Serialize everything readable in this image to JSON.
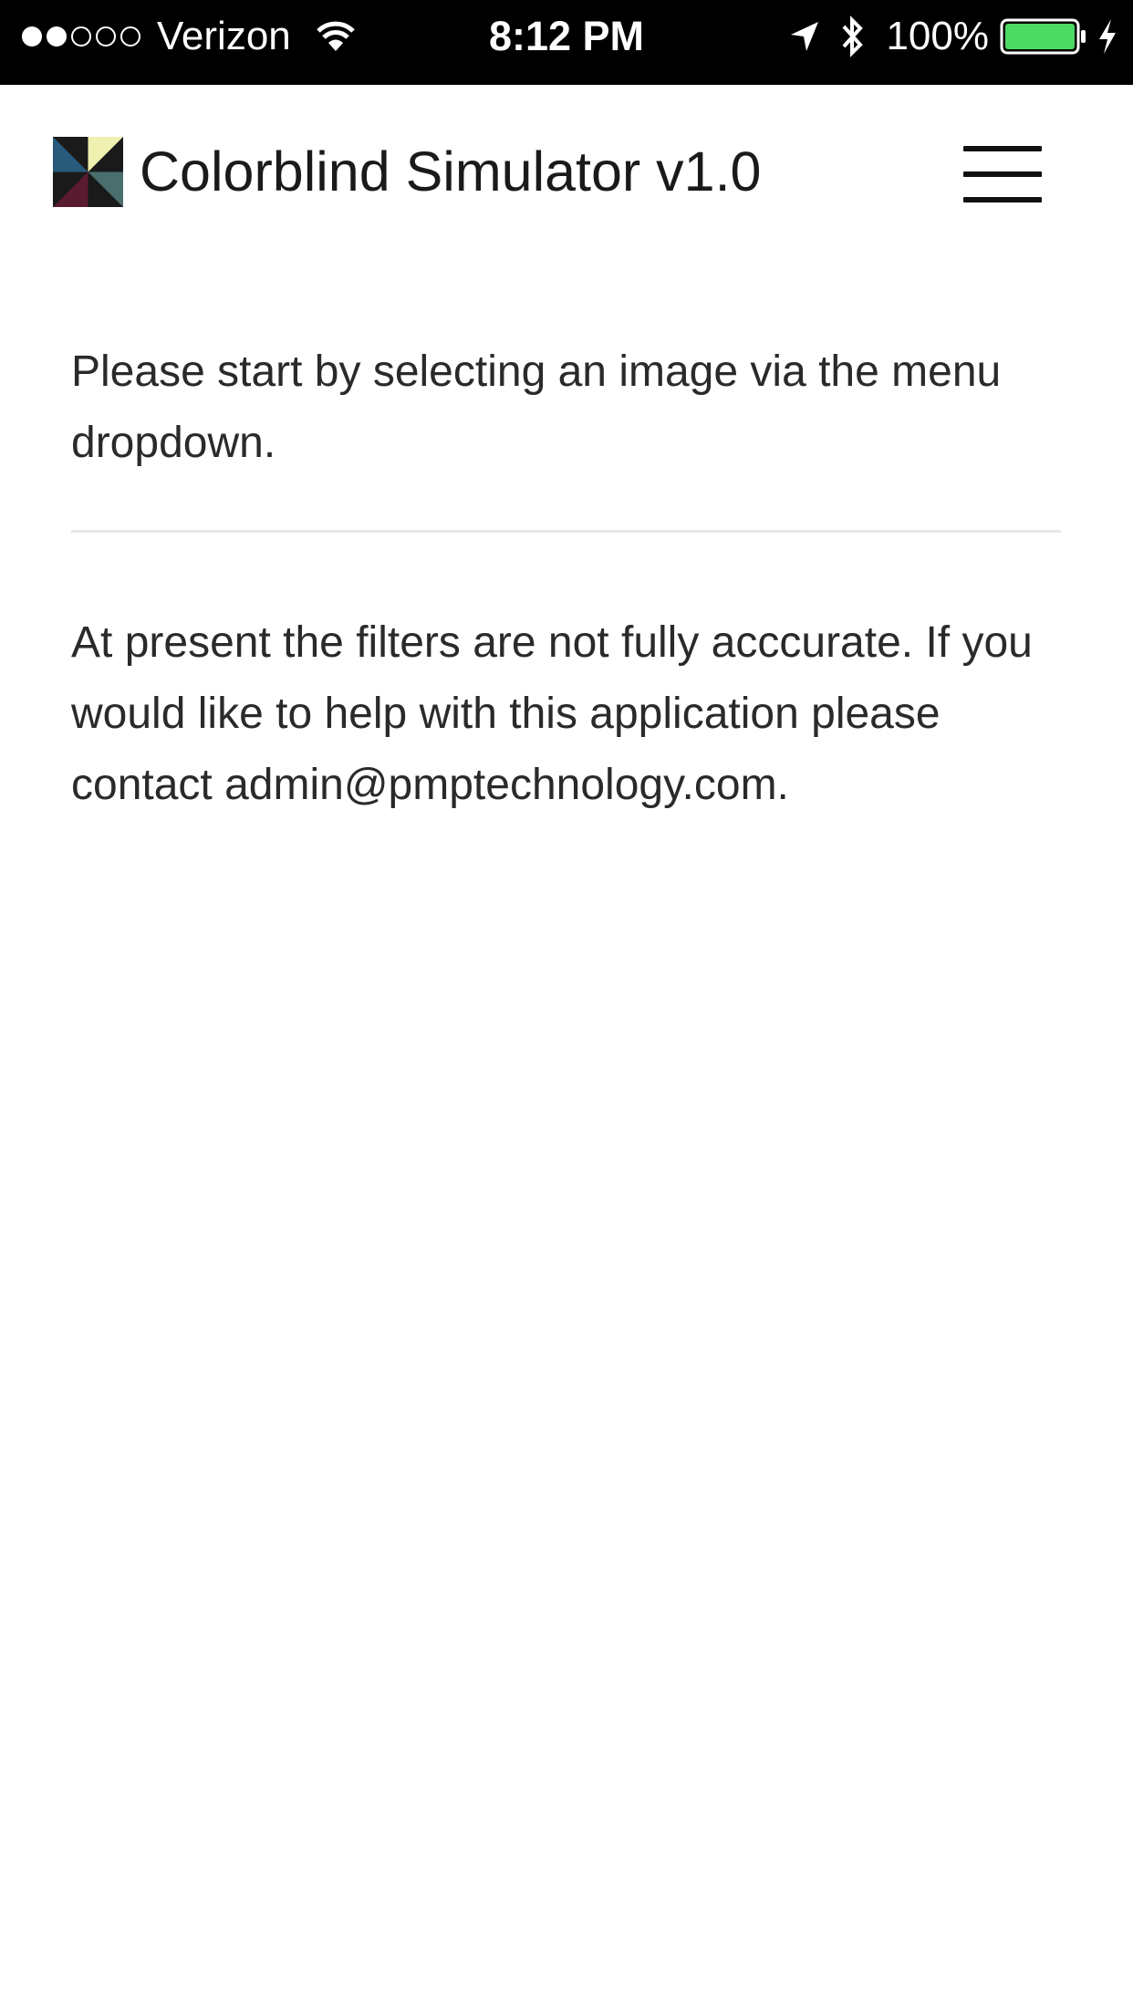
{
  "status_bar": {
    "signal": {
      "filled": 2,
      "total": 5
    },
    "carrier": "Verizon",
    "time": "8:12 PM",
    "battery_percent": "100%",
    "battery_level": 1.0,
    "battery_color": "#4cd964",
    "icons": [
      "wifi-icon",
      "location-arrow-icon",
      "bluetooth-icon",
      "battery-icon",
      "charging-bolt-icon"
    ]
  },
  "header": {
    "title": "Colorblind Simulator v1.0",
    "logo": {
      "icon": "app-logo",
      "colors": [
        "#2a5a7a",
        "#f0f0b0",
        "#4a6e6e",
        "#5a1a30"
      ]
    },
    "menu_icon": "hamburger-menu-icon"
  },
  "main": {
    "instruction": "Please start by selecting an image via the menu dropdown.",
    "notice": "At present the filters are not fully acccurate. If you would like to help with this application please contact admin@pmptechnology.com."
  },
  "colors": {
    "status_bar_bg": "#000000",
    "page_bg": "#ffffff",
    "text": "#2a2a2a",
    "divider": "#e6e6e6"
  }
}
